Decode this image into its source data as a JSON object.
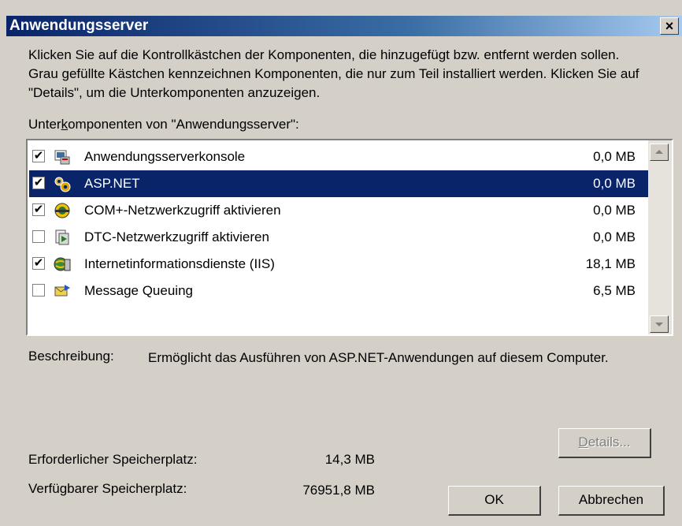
{
  "window": {
    "title": "Anwendungsserver",
    "close_label": "×"
  },
  "intro_text": "Klicken Sie auf die Kontrollkästchen der Komponenten, die hinzugefügt bzw. entfernt werden sollen. Grau gefüllte Kästchen kennzeichnen Komponenten, die nur zum Teil installiert werden. Klicken Sie auf \"Details\", um die Unterkomponenten anzuzeigen.",
  "list_label": {
    "pre": "Unter",
    "accel": "k",
    "post": "omponenten von \"Anwendungsserver\":"
  },
  "components": [
    {
      "label": "Anwendungsserverkonsole",
      "size": "0,0 MB",
      "checked": true,
      "icon": "console-icon",
      "selected": false
    },
    {
      "label": "ASP.NET",
      "size": "0,0 MB",
      "checked": true,
      "icon": "gears-icon",
      "selected": true
    },
    {
      "label": "COM+-Netzwerkzugriff aktivieren",
      "size": "0,0 MB",
      "checked": true,
      "icon": "com-icon",
      "selected": false
    },
    {
      "label": "DTC-Netzwerkzugriff aktivieren",
      "size": "0,0 MB",
      "checked": false,
      "icon": "dtc-icon",
      "selected": false
    },
    {
      "label": "Internetinformationsdienste (IIS)",
      "size": "18,1 MB",
      "checked": true,
      "partial": true,
      "icon": "iis-icon",
      "selected": false
    },
    {
      "label": "Message Queuing",
      "size": "6,5 MB",
      "checked": false,
      "icon": "message-queue-icon",
      "selected": false
    }
  ],
  "description": {
    "label": "Beschreibung:",
    "text": "Ermöglicht das Ausführen von ASP.NET-Anwendungen auf diesem Computer."
  },
  "space": {
    "required_label": "Erforderlicher Speicherplatz:",
    "required_value": "14,3 MB",
    "available_label": "Verfügbarer Speicherplatz:",
    "available_value": "76951,8 MB"
  },
  "buttons": {
    "details_accel": "D",
    "details_rest": "etails...",
    "ok": "OK",
    "cancel": "Abbrechen"
  },
  "colors": {
    "dialog_bg": "#d4d0c8",
    "selection": "#0a246a"
  }
}
